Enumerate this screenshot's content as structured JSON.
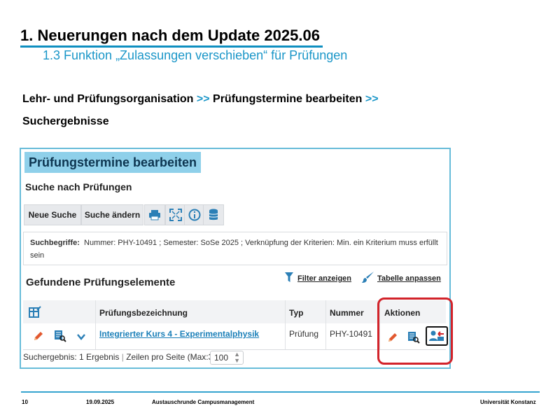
{
  "slide": {
    "title": "1. Neuerungen nach dem Update 2025.06",
    "subtitle": "1.3 Funktion „Zulassungen verschieben“ für Prüfungen",
    "breadcrumb": {
      "part1": "Lehr- und Prüfungsorganisation",
      "sep": ">>",
      "part2": "Prüfungstermine bearbeiten",
      "part3": "Suchergebnisse"
    }
  },
  "app": {
    "title": "Prüfungstermine bearbeiten",
    "search_heading": "Suche nach Prüfungen",
    "toolbar": {
      "new_search": "Neue Suche",
      "change_search": "Suche ändern",
      "icons": [
        "printer-icon",
        "expand-icon",
        "info-icon",
        "database-icon"
      ]
    },
    "criteria": {
      "label": "Suchbegriffe:",
      "text": "Nummer: PHY-10491 ; Semester: SoSe 2025 ; Verknüpfung der Kriterien: Min. ein Kriterium muss erfüllt sein"
    },
    "results": {
      "heading": "Gefundene Prüfungselemente",
      "filter_label": "Filter anzeigen",
      "table_label": "Tabelle anpassen",
      "columns": [
        "Prüfungsbezeichnung",
        "Typ",
        "Nummer",
        "Aktionen"
      ],
      "rows": [
        {
          "name": "Integrierter Kurs 4 - Experimentalphysik",
          "type": "Prüfung",
          "number": "PHY-10491"
        }
      ]
    },
    "pager": {
      "result_text": "Suchergebnis: 1 Ergebnis",
      "per_page_label": "Zeilen pro Seite (Max:300)",
      "per_page_value": "100"
    },
    "colors": {
      "accent": "#1a96c8",
      "highlight": "#d2232a",
      "title_bg": "#8fd0ea"
    }
  },
  "footer": {
    "page": "10",
    "date": "19.09.2025",
    "event": "Austauschrunde Campusmanagement",
    "org": "Universität Konstanz"
  }
}
